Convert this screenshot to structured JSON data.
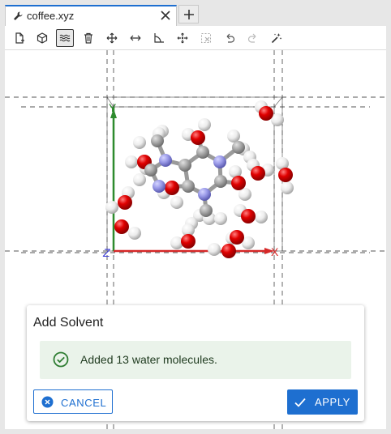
{
  "tab": {
    "title": "coffee.xyz",
    "icon": "wrench-icon"
  },
  "toolbar": {
    "buttons": [
      {
        "name": "new-file-icon"
      },
      {
        "name": "cube-icon"
      },
      {
        "name": "solvent-waves-icon",
        "active": true
      },
      {
        "name": "trash-icon"
      },
      {
        "name": "move-icon"
      },
      {
        "name": "horizontal-arrows-icon"
      },
      {
        "name": "angle-icon"
      },
      {
        "name": "rotate-move-icon"
      },
      {
        "name": "deselect-icon"
      },
      {
        "name": "undo-icon"
      },
      {
        "name": "redo-icon"
      },
      {
        "name": "magic-wand-icon"
      }
    ]
  },
  "viewport": {
    "axes": {
      "x": "X",
      "y": "Y",
      "z": "Z"
    },
    "colors": {
      "x_axis": "#d62828",
      "y_axis": "#2e8b2e",
      "z_axis": "#3a3ad6",
      "oxygen": "#e00000",
      "hydrogen": "#f2f2f2",
      "carbon": "#a9a9a9",
      "nitrogen": "#9a9ae8"
    }
  },
  "dialog": {
    "title": "Add Solvent",
    "alert": {
      "text": "Added 13 water molecules.",
      "color": "#2e7d32"
    },
    "cancel_label": "CANCEL",
    "apply_label": "APPLY",
    "accent": "#1e6fd0"
  }
}
